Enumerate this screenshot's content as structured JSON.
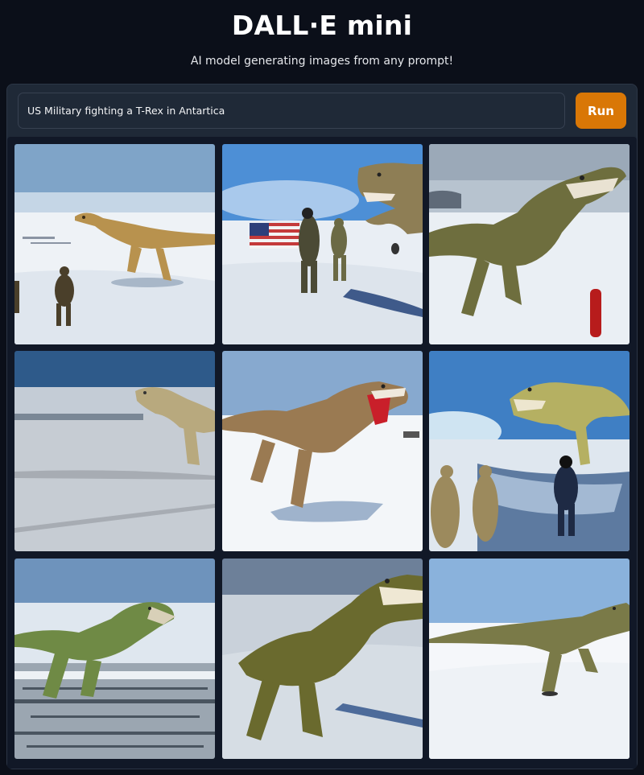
{
  "app": {
    "title": "DALL·E mini",
    "subtitle": "AI model generating images from any prompt!"
  },
  "prompt": {
    "value": "US Military fighting a T-Rex in Antartica"
  },
  "run_button": {
    "label": "Run"
  },
  "colors": {
    "background": "#0b0f19",
    "panel": "#1f2937",
    "accent": "#d97706"
  },
  "gallery": {
    "count": 9
  }
}
